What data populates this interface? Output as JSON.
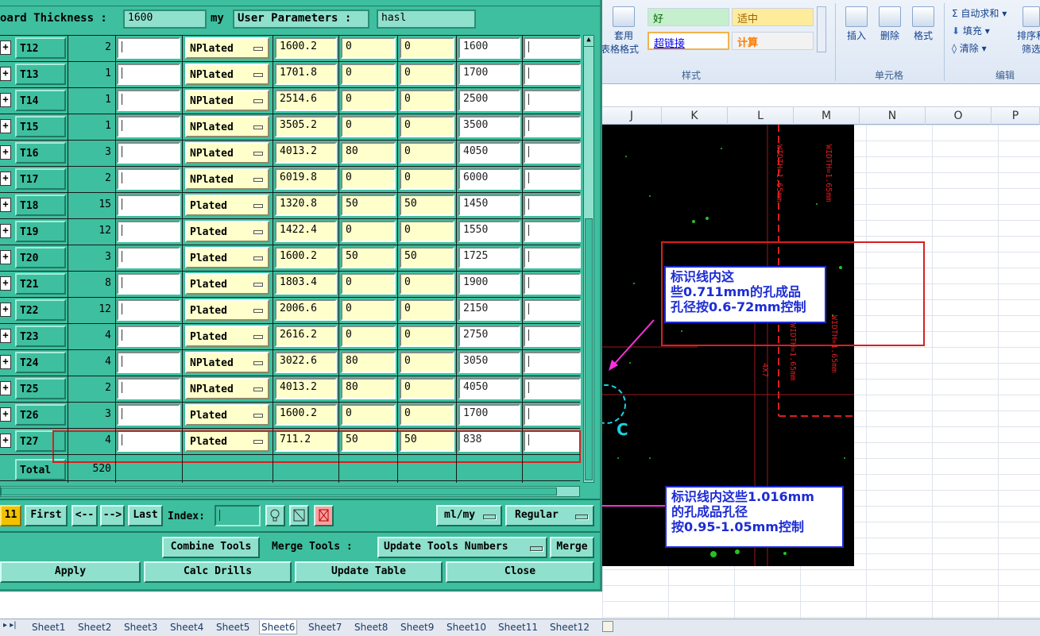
{
  "window": {
    "board_thickness_label": "oard Thickness :",
    "board_thickness_value": "1600",
    "unit": "my",
    "user_params_label": "User Parameters :",
    "user_params_value": "hasl"
  },
  "tools": [
    {
      "tool": "T12",
      "count": "2",
      "type": "NPlated",
      "finish": "1600.2",
      "tol_plus": "0",
      "tol_minus": "0",
      "drill": "1600"
    },
    {
      "tool": "T13",
      "count": "1",
      "type": "NPlated",
      "finish": "1701.8",
      "tol_plus": "0",
      "tol_minus": "0",
      "drill": "1700"
    },
    {
      "tool": "T14",
      "count": "1",
      "type": "NPlated",
      "finish": "2514.6",
      "tol_plus": "0",
      "tol_minus": "0",
      "drill": "2500"
    },
    {
      "tool": "T15",
      "count": "1",
      "type": "NPlated",
      "finish": "3505.2",
      "tol_plus": "0",
      "tol_minus": "0",
      "drill": "3500"
    },
    {
      "tool": "T16",
      "count": "3",
      "type": "NPlated",
      "finish": "4013.2",
      "tol_plus": "80",
      "tol_minus": "0",
      "drill": "4050"
    },
    {
      "tool": "T17",
      "count": "2",
      "type": "NPlated",
      "finish": "6019.8",
      "tol_plus": "0",
      "tol_minus": "0",
      "drill": "6000"
    },
    {
      "tool": "T18",
      "count": "15",
      "type": "Plated",
      "finish": "1320.8",
      "tol_plus": "50",
      "tol_minus": "50",
      "drill": "1450"
    },
    {
      "tool": "T19",
      "count": "12",
      "type": "Plated",
      "finish": "1422.4",
      "tol_plus": "0",
      "tol_minus": "0",
      "drill": "1550"
    },
    {
      "tool": "T20",
      "count": "3",
      "type": "Plated",
      "finish": "1600.2",
      "tol_plus": "50",
      "tol_minus": "50",
      "drill": "1725"
    },
    {
      "tool": "T21",
      "count": "8",
      "type": "Plated",
      "finish": "1803.4",
      "tol_plus": "0",
      "tol_minus": "0",
      "drill": "1900"
    },
    {
      "tool": "T22",
      "count": "12",
      "type": "Plated",
      "finish": "2006.6",
      "tol_plus": "0",
      "tol_minus": "0",
      "drill": "2150"
    },
    {
      "tool": "T23",
      "count": "4",
      "type": "Plated",
      "finish": "2616.2",
      "tol_plus": "0",
      "tol_minus": "0",
      "drill": "2750"
    },
    {
      "tool": "T24",
      "count": "4",
      "type": "NPlated",
      "finish": "3022.6",
      "tol_plus": "80",
      "tol_minus": "0",
      "drill": "3050"
    },
    {
      "tool": "T25",
      "count": "2",
      "type": "NPlated",
      "finish": "4013.2",
      "tol_plus": "80",
      "tol_minus": "0",
      "drill": "4050"
    },
    {
      "tool": "T26",
      "count": "3",
      "type": "Plated",
      "finish": "1600.2",
      "tol_plus": "0",
      "tol_minus": "0",
      "drill": "1700"
    },
    {
      "tool": "T27",
      "count": "4",
      "type": "Plated",
      "finish": "711.2",
      "tol_plus": "50",
      "tol_minus": "50",
      "drill": "838"
    }
  ],
  "total": {
    "label": "Total",
    "value": "520"
  },
  "nav": {
    "page_left": "11",
    "first": "First",
    "prev": "<--",
    "next": "-->",
    "last": "Last",
    "index_label": "Index:",
    "units": "ml/my",
    "mode": "Regular"
  },
  "actions": {
    "combine": "Combine Tools",
    "merge_label": "Merge Tools :",
    "update_numbers": "Update Tools Numbers",
    "merge": "Merge",
    "apply": "Apply",
    "calc": "Calc Drills",
    "update_table": "Update Table",
    "close": "Close"
  },
  "ribbon": {
    "apply_table_fmt": "套用",
    "apply_table_fmt2": "表格格式",
    "style_good": "好",
    "style_neutral": "适中",
    "style_link": "超链接",
    "style_calc": "计算",
    "styles_group": "样式",
    "insert": "插入",
    "delete": "删除",
    "format": "格式",
    "cells_group": "单元格",
    "autosum": "自动求和",
    "fill": "填充",
    "clear": "清除",
    "sort": "排序和",
    "filter": "筛选",
    "edit_group": "编辑"
  },
  "columns": [
    "J",
    "K",
    "L",
    "M",
    "N",
    "O",
    "P"
  ],
  "cad": {
    "annotation1": [
      "标识线内这",
      "些0.711mm的孔成品",
      "孔径按0.6-72mm控制"
    ],
    "annotation2": [
      "标识线内这些1.016mm",
      "的孔成品孔径",
      "按0.95-1.05mm控制"
    ],
    "width_label_a": "WIDTH=1.65mm",
    "width_label_b": "WIDTH=1.65mm",
    "width_label_c": "WIDTH=1.65mm",
    "width_label_d": "WIDTH=1.65mm",
    "small_label": "4X7",
    "hole_label": "C"
  },
  "sheets": [
    "Sheet1",
    "Sheet2",
    "Sheet3",
    "Sheet4",
    "Sheet5",
    "Sheet6",
    "Sheet7",
    "Sheet8",
    "Sheet9",
    "Sheet10",
    "Sheet11",
    "Sheet12"
  ],
  "active_sheet": "Sheet6",
  "colors": {
    "window_bg": "#3ebf9f",
    "highlight_red": "#d91f1f",
    "annot_blue": "#1d2cd4",
    "arrow_magenta": "#ff2ee0"
  }
}
